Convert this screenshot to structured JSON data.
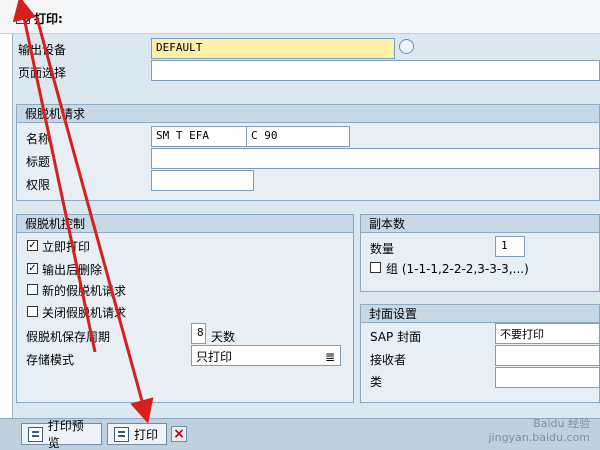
{
  "window": {
    "title": "打印:"
  },
  "fields": {
    "output_device_label": "输出设备",
    "output_device_value": "DEFAULT",
    "page_selection_label": "页面选择",
    "page_selection_value": ""
  },
  "spool_request": {
    "section_title": "假脱机请求",
    "name_label": "名称",
    "name_part1": "SM    T    EFA",
    "name_part2": "C      90",
    "title_label": "标题",
    "title_value": "",
    "authority_label": "权限",
    "authority_value": ""
  },
  "spool_control": {
    "section_title": "假脱机控制",
    "items": [
      {
        "label": "立即打印",
        "checked": true
      },
      {
        "label": "输出后删除",
        "checked": true
      },
      {
        "label": "新的假脱机请求",
        "checked": false
      },
      {
        "label": "关闭假脱机请求",
        "checked": false
      }
    ],
    "retention_label": "假脱机保存周期",
    "retention_value": "8",
    "retention_unit": "天数",
    "storage_mode_label": "存储模式",
    "storage_mode_value": "只打印"
  },
  "copies": {
    "section_title": "副本数",
    "quantity_label": "数量",
    "quantity_value": "1",
    "group_label": "组 (1-1-1,2-2-2,3-3-3,...)"
  },
  "cover_page": {
    "section_title": "封面设置",
    "sap_cover_label": "SAP 封面",
    "sap_cover_value": "不要打印",
    "recipient_label": "接收者",
    "recipient_value": "",
    "class_label": "类",
    "class_value": ""
  },
  "footer": {
    "preview_button": "打印预览",
    "print_button": "打印"
  },
  "watermark": {
    "line1": "Baidu 经验",
    "line2": "jingyan.baidu.com"
  }
}
